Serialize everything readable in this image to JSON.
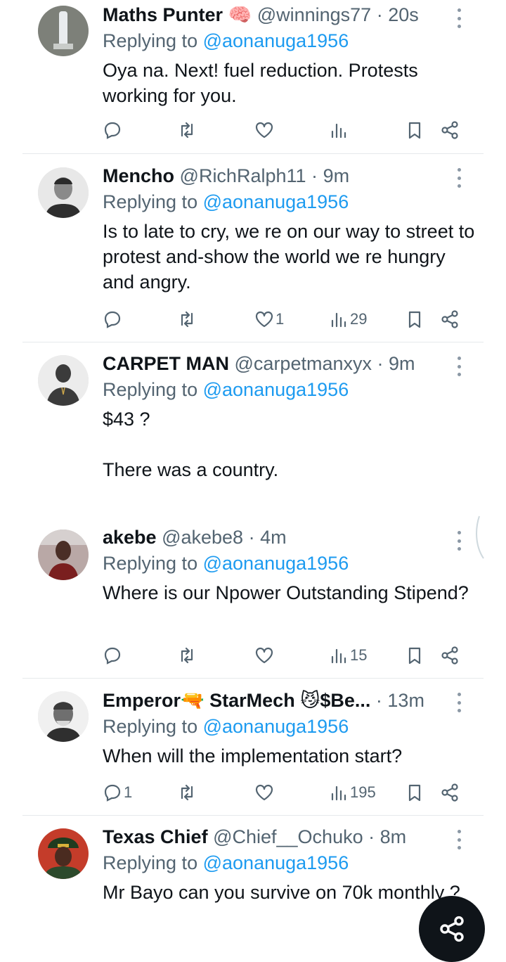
{
  "reply_prefix": "Replying to",
  "tweets": [
    {
      "name": "Maths Punter",
      "emoji": "🧠",
      "handle": "@winnings77",
      "time": "20s",
      "replying_to": "@aonanuga1956",
      "text": "Oya na. Next!  fuel reduction. Protests working for you.",
      "replies": "",
      "likes": "",
      "views": ""
    },
    {
      "name": "Mencho",
      "emoji": "",
      "handle": "@RichRalph11",
      "time": "9m",
      "replying_to": "@aonanuga1956",
      "text": "Is to late to cry, we re on our way to street to protest and-show the world we re hungry and angry.",
      "replies": "",
      "likes": "1",
      "views": "29"
    },
    {
      "name": "CARPET MAN",
      "emoji": "",
      "handle": "@carpetmanxyx",
      "time": "9m",
      "replying_to": "@aonanuga1956",
      "text": "$43 ?\n\nThere was a country.",
      "replies": "",
      "likes": "",
      "views": ""
    },
    {
      "name": "akebe",
      "emoji": "",
      "handle": "@akebe8",
      "time": "4m",
      "replying_to": "@aonanuga1956",
      "text": "Where is our Npower Outstanding Stipend?",
      "replies": "",
      "likes": "",
      "views": "15"
    },
    {
      "name": "Emperor🔫 StarMech 😼$Be...",
      "emoji": "",
      "handle": "",
      "time": "13m",
      "replying_to": "@aonanuga1956",
      "text": "When will the implementation start?",
      "replies": "1",
      "likes": "",
      "views": "195"
    },
    {
      "name": "Texas Chief",
      "emoji": "",
      "handle": "@Chief__Ochuko",
      "time": "8m",
      "replying_to": "@aonanuga1956",
      "text": "Mr Bayo can you survive on 70k monthly ?",
      "replies": "",
      "likes": "",
      "views": ""
    }
  ],
  "icons": {
    "reply": "reply-icon",
    "retweet": "retweet-icon",
    "like": "heart-icon",
    "views": "views-icon",
    "bookmark": "bookmark-icon",
    "share": "share-icon",
    "more": "more-icon",
    "fab": "share-fab-icon"
  },
  "colors": {
    "mention": "#1d9bf0",
    "muted": "#536471",
    "text": "#0f1419"
  }
}
